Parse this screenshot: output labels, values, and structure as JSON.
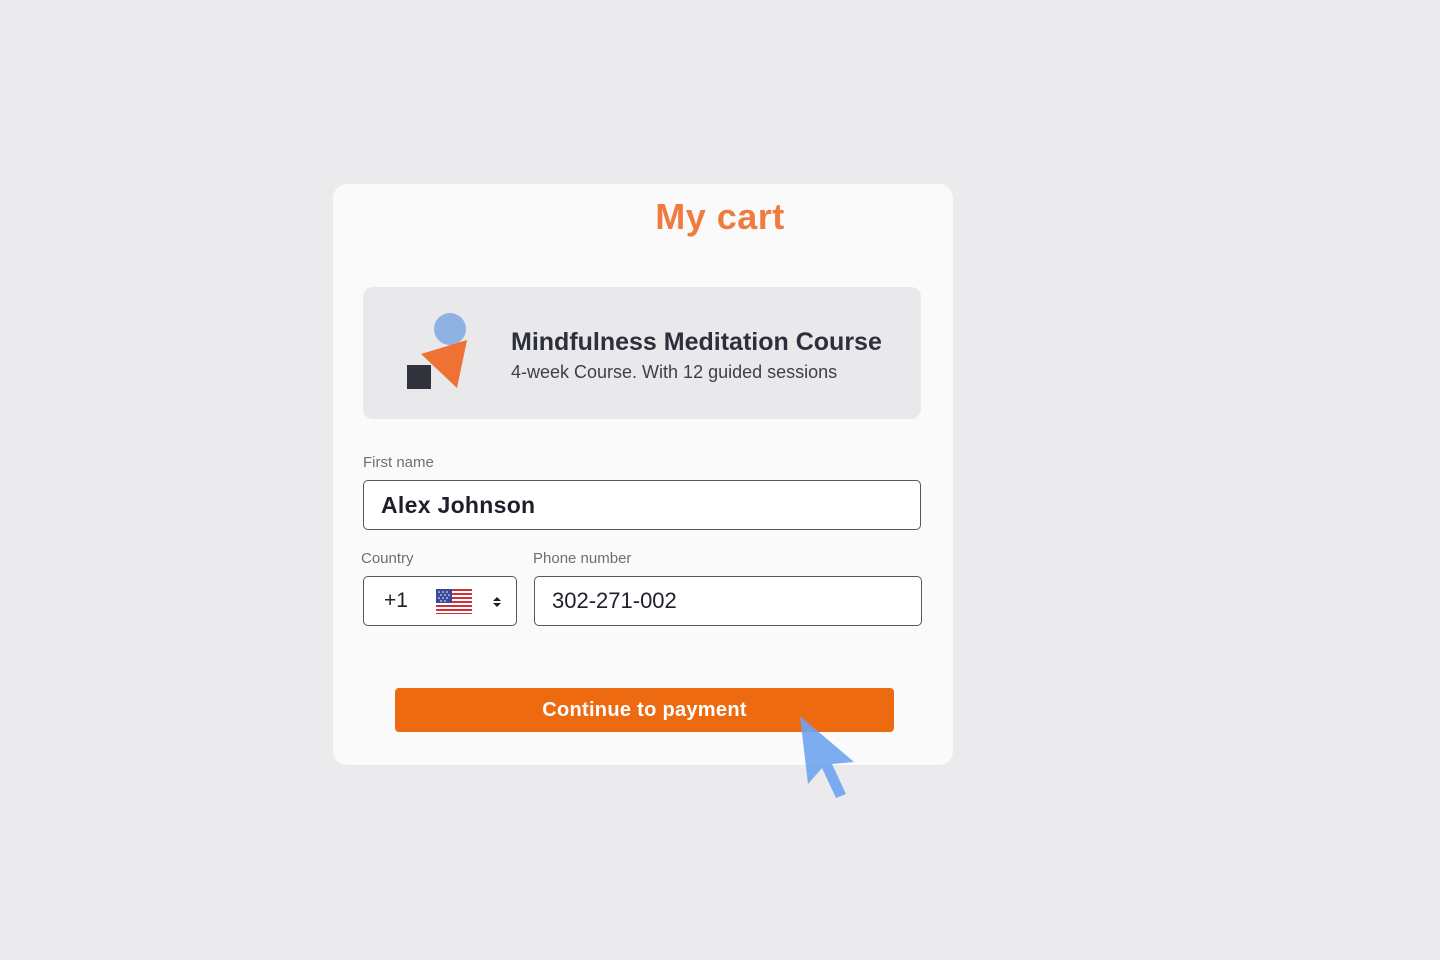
{
  "cart": {
    "title": "My cart",
    "product": {
      "name": "Mindfulness Meditation Course",
      "description": "4-week Course. With 12 guided sessions",
      "icon": "abstract-shapes-icon"
    },
    "form": {
      "first_name_label": "First name",
      "first_name_value": "Alex Johnson",
      "country_label": "Country",
      "country_code": "+1",
      "country_flag": "us-flag-icon",
      "phone_label": "Phone number",
      "phone_value": "302-271-002"
    },
    "continue_label": "Continue to payment"
  },
  "colors": {
    "accent": "#ee6a10",
    "title": "#f07b3f",
    "background": "#ebebed",
    "card": "#fafafa",
    "cursor": "#6fa3ef"
  }
}
